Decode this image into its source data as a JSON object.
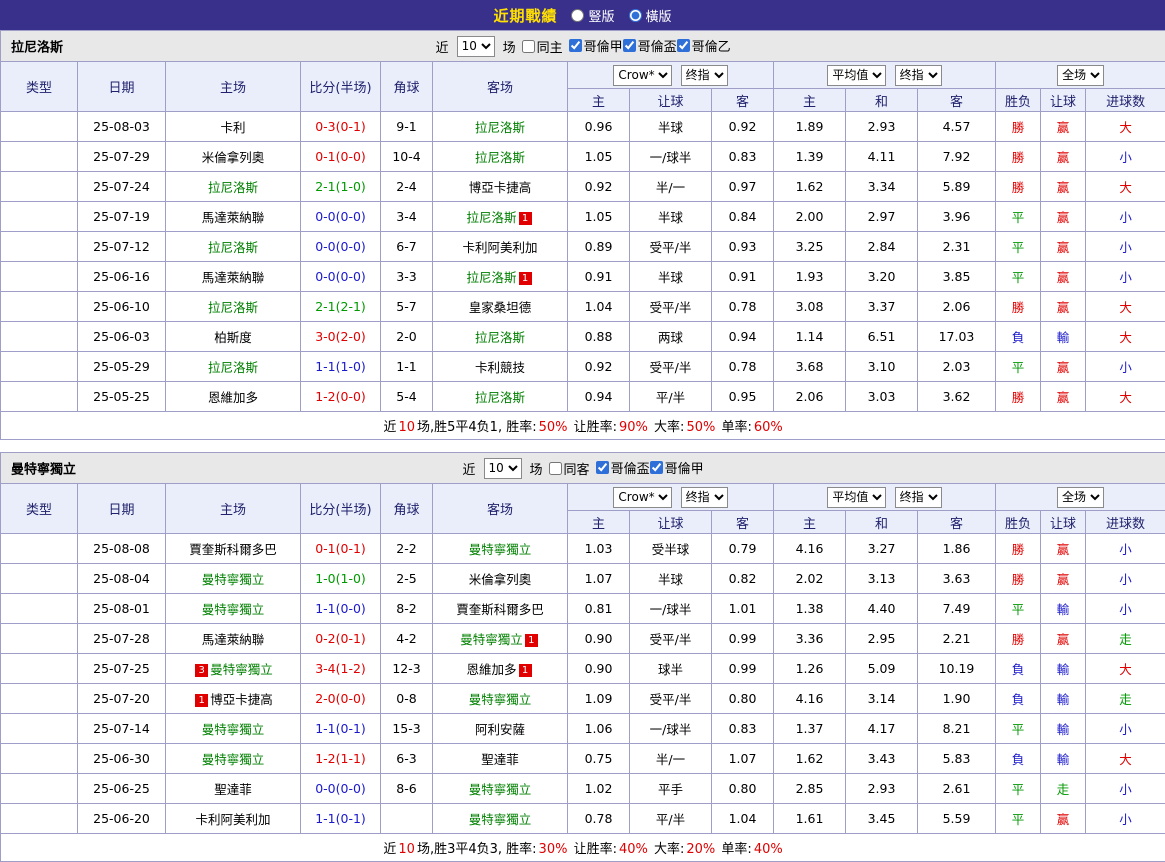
{
  "top_bar": {
    "title": "近期戰績",
    "options": [
      {
        "label": "豎版",
        "selected": false
      },
      {
        "label": "橫版",
        "selected": true
      }
    ]
  },
  "labels": {
    "recent": "近",
    "matches": "场"
  },
  "colors": {
    "topbar_bg": "#39308b",
    "title_yellow": "#ffe000",
    "league_red": "#d60000",
    "league_magenta": "#cc00cc",
    "win_red": "#e00000",
    "draw_green": "#009900",
    "lose_blue": "#1a1acc",
    "focal_team_green": "#008000",
    "header_bg": "#e9eefa"
  },
  "table_header": {
    "type": "类型",
    "date": "日期",
    "home": "主场",
    "score": "比分(半场)",
    "corner": "角球",
    "away": "客场",
    "selects": {
      "company": "Crow*",
      "final1": "终指",
      "average": "平均值",
      "final2": "终指",
      "scope": "全场"
    },
    "sub": {
      "home": "主",
      "handicap": "让球",
      "away": "客",
      "avg_home": "主",
      "draw": "和",
      "avg_away": "客",
      "result": "胜负",
      "handicap_result": "让球",
      "goals": "进球数"
    }
  },
  "sections": [
    {
      "team": "拉尼洛斯",
      "filters": {
        "recent_value": "10",
        "same_label": "同主",
        "same_checked": false,
        "leagues": [
          "哥倫甲",
          "哥倫盃",
          "哥倫乙"
        ]
      },
      "rows": [
        {
          "league": "哥倫甲",
          "league_color": "red",
          "date": "25-08-03",
          "home": {
            "name": "卡利",
            "focal": false
          },
          "score": {
            "text": "0-3(0-1)",
            "color": "red"
          },
          "corner": "9-1",
          "away": {
            "name": "拉尼洛斯",
            "focal": true
          },
          "crown": [
            "0.96",
            "半球",
            "0.92"
          ],
          "average": [
            "1.89",
            "2.93",
            "4.57"
          ],
          "result": [
            "勝",
            "red"
          ],
          "handicap": [
            "赢",
            "red"
          ],
          "goals": [
            "大",
            "red"
          ]
        },
        {
          "league": "哥倫甲",
          "league_color": "red",
          "date": "25-07-29",
          "home": {
            "name": "米倫拿列奧",
            "focal": false
          },
          "score": {
            "text": "0-1(0-0)",
            "color": "red"
          },
          "corner": "10-4",
          "away": {
            "name": "拉尼洛斯",
            "focal": true
          },
          "crown": [
            "1.05",
            "一/球半",
            "0.83"
          ],
          "average": [
            "1.39",
            "4.11",
            "7.92"
          ],
          "result": [
            "勝",
            "red"
          ],
          "handicap": [
            "赢",
            "red"
          ],
          "goals": [
            "小",
            "blue"
          ]
        },
        {
          "league": "哥倫甲",
          "league_color": "red",
          "date": "25-07-24",
          "home": {
            "name": "拉尼洛斯",
            "focal": true
          },
          "score": {
            "text": "2-1(1-0)",
            "color": "green"
          },
          "corner": "2-4",
          "away": {
            "name": "博亞卡捷高",
            "focal": false
          },
          "crown": [
            "0.92",
            "半/一",
            "0.97"
          ],
          "average": [
            "1.62",
            "3.34",
            "5.89"
          ],
          "result": [
            "勝",
            "red"
          ],
          "handicap": [
            "赢",
            "red"
          ],
          "goals": [
            "大",
            "red"
          ]
        },
        {
          "league": "哥倫甲",
          "league_color": "red",
          "date": "25-07-19",
          "home": {
            "name": "馬達萊納聯",
            "focal": false
          },
          "score": {
            "text": "0-0(0-0)",
            "color": "blue"
          },
          "corner": "3-4",
          "away": {
            "name": "拉尼洛斯",
            "focal": true,
            "post": "1"
          },
          "crown": [
            "1.05",
            "半球",
            "0.84"
          ],
          "average": [
            "2.00",
            "2.97",
            "3.96"
          ],
          "result": [
            "平",
            "green"
          ],
          "handicap": [
            "赢",
            "red"
          ],
          "goals": [
            "小",
            "blue"
          ]
        },
        {
          "league": "哥倫甲",
          "league_color": "red",
          "date": "25-07-12",
          "home": {
            "name": "拉尼洛斯",
            "focal": true
          },
          "score": {
            "text": "0-0(0-0)",
            "color": "blue"
          },
          "corner": "6-7",
          "away": {
            "name": "卡利阿美利加",
            "focal": false
          },
          "crown": [
            "0.89",
            "受平/半",
            "0.93"
          ],
          "average": [
            "3.25",
            "2.84",
            "2.31"
          ],
          "result": [
            "平",
            "green"
          ],
          "handicap": [
            "赢",
            "red"
          ],
          "goals": [
            "小",
            "blue"
          ]
        },
        {
          "league": "哥倫盃",
          "league_color": "magenta",
          "date": "25-06-16",
          "home": {
            "name": "馬達萊納聯",
            "focal": false
          },
          "score": {
            "text": "0-0(0-0)",
            "color": "blue"
          },
          "corner": "3-3",
          "away": {
            "name": "拉尼洛斯",
            "focal": true,
            "post": "1"
          },
          "crown": [
            "0.91",
            "半球",
            "0.91"
          ],
          "average": [
            "1.93",
            "3.20",
            "3.85"
          ],
          "result": [
            "平",
            "green"
          ],
          "handicap": [
            "赢",
            "red"
          ],
          "goals": [
            "小",
            "blue"
          ]
        },
        {
          "league": "哥倫盃",
          "league_color": "magenta",
          "date": "25-06-10",
          "home": {
            "name": "拉尼洛斯",
            "focal": true
          },
          "score": {
            "text": "2-1(2-1)",
            "color": "green"
          },
          "corner": "5-7",
          "away": {
            "name": "皇家桑坦德",
            "focal": false
          },
          "crown": [
            "1.04",
            "受平/半",
            "0.78"
          ],
          "average": [
            "3.08",
            "3.37",
            "2.06"
          ],
          "result": [
            "勝",
            "red"
          ],
          "handicap": [
            "赢",
            "red"
          ],
          "goals": [
            "大",
            "red"
          ]
        },
        {
          "league": "哥倫盃",
          "league_color": "magenta",
          "date": "25-06-03",
          "home": {
            "name": "柏斯度",
            "focal": false
          },
          "score": {
            "text": "3-0(2-0)",
            "color": "red"
          },
          "corner": "2-0",
          "away": {
            "name": "拉尼洛斯",
            "focal": true
          },
          "crown": [
            "0.88",
            "两球",
            "0.94"
          ],
          "average": [
            "1.14",
            "6.51",
            "17.03"
          ],
          "result": [
            "負",
            "blue"
          ],
          "handicap": [
            "輸",
            "blue"
          ],
          "goals": [
            "大",
            "red"
          ]
        },
        {
          "league": "哥倫盃",
          "league_color": "magenta",
          "date": "25-05-29",
          "home": {
            "name": "拉尼洛斯",
            "focal": true
          },
          "score": {
            "text": "1-1(1-0)",
            "color": "blue"
          },
          "corner": "1-1",
          "away": {
            "name": "卡利競技",
            "focal": false
          },
          "crown": [
            "0.92",
            "受平/半",
            "0.78"
          ],
          "average": [
            "3.68",
            "3.10",
            "2.03"
          ],
          "result": [
            "平",
            "green"
          ],
          "handicap": [
            "赢",
            "red"
          ],
          "goals": [
            "小",
            "blue"
          ]
        },
        {
          "league": "哥倫甲",
          "league_color": "red",
          "date": "25-05-25",
          "home": {
            "name": "恩維加多",
            "focal": false
          },
          "score": {
            "text": "1-2(0-0)",
            "color": "red"
          },
          "corner": "5-4",
          "away": {
            "name": "拉尼洛斯",
            "focal": true
          },
          "crown": [
            "0.94",
            "平/半",
            "0.95"
          ],
          "average": [
            "2.06",
            "3.03",
            "3.62"
          ],
          "result": [
            "勝",
            "red"
          ],
          "handicap": [
            "赢",
            "red"
          ],
          "goals": [
            "大",
            "red"
          ]
        }
      ],
      "summary": [
        [
          "近",
          ""
        ],
        [
          "10",
          "red"
        ],
        [
          "场,胜5平4负1, 胜率:",
          ""
        ],
        [
          "50%",
          "red"
        ],
        [
          " 让胜率:",
          ""
        ],
        [
          "90%",
          "red"
        ],
        [
          " 大率:",
          ""
        ],
        [
          "50%",
          "red"
        ],
        [
          " 单率:",
          ""
        ],
        [
          "60%",
          "red"
        ]
      ]
    },
    {
      "team": "曼特寧獨立",
      "filters": {
        "recent_value": "10",
        "same_label": "同客",
        "same_checked": false,
        "leagues": [
          "哥倫盃",
          "哥倫甲"
        ]
      },
      "rows": [
        {
          "league": "哥倫盃",
          "league_color": "magenta",
          "date": "25-08-08",
          "home": {
            "name": "賈奎斯科爾多巴",
            "focal": false
          },
          "score": {
            "text": "0-1(0-1)",
            "color": "red"
          },
          "corner": "2-2",
          "away": {
            "name": "曼特寧獨立",
            "focal": true
          },
          "crown": [
            "1.03",
            "受半球",
            "0.79"
          ],
          "average": [
            "4.16",
            "3.27",
            "1.86"
          ],
          "result": [
            "勝",
            "red"
          ],
          "handicap": [
            "赢",
            "red"
          ],
          "goals": [
            "小",
            "blue"
          ]
        },
        {
          "league": "哥倫甲",
          "league_color": "red",
          "date": "25-08-04",
          "home": {
            "name": "曼特寧獨立",
            "focal": true
          },
          "score": {
            "text": "1-0(1-0)",
            "color": "green"
          },
          "corner": "2-5",
          "away": {
            "name": "米倫拿列奧",
            "focal": false
          },
          "crown": [
            "1.07",
            "半球",
            "0.82"
          ],
          "average": [
            "2.02",
            "3.13",
            "3.63"
          ],
          "result": [
            "勝",
            "red"
          ],
          "handicap": [
            "赢",
            "red"
          ],
          "goals": [
            "小",
            "blue"
          ]
        },
        {
          "league": "哥倫盃",
          "league_color": "magenta",
          "date": "25-08-01",
          "home": {
            "name": "曼特寧獨立",
            "focal": true
          },
          "score": {
            "text": "1-1(0-0)",
            "color": "blue"
          },
          "corner": "8-2",
          "away": {
            "name": "賈奎斯科爾多巴",
            "focal": false
          },
          "crown": [
            "0.81",
            "一/球半",
            "1.01"
          ],
          "average": [
            "1.38",
            "4.40",
            "7.49"
          ],
          "result": [
            "平",
            "green"
          ],
          "handicap": [
            "輸",
            "blue"
          ],
          "goals": [
            "小",
            "blue"
          ]
        },
        {
          "league": "哥倫甲",
          "league_color": "red",
          "date": "25-07-28",
          "home": {
            "name": "馬達萊納聯",
            "focal": false
          },
          "score": {
            "text": "0-2(0-1)",
            "color": "red"
          },
          "corner": "4-2",
          "away": {
            "name": "曼特寧獨立",
            "focal": true,
            "post": "1"
          },
          "crown": [
            "0.90",
            "受平/半",
            "0.99"
          ],
          "average": [
            "3.36",
            "2.95",
            "2.21"
          ],
          "result": [
            "勝",
            "red"
          ],
          "handicap": [
            "赢",
            "red"
          ],
          "goals": [
            "走",
            "green"
          ]
        },
        {
          "league": "哥倫甲",
          "league_color": "red",
          "date": "25-07-25",
          "home": {
            "name": "曼特寧獨立",
            "focal": true,
            "pre": "3"
          },
          "score": {
            "text": "3-4(1-2)",
            "color": "red"
          },
          "corner": "12-3",
          "away": {
            "name": "恩維加多",
            "focal": false,
            "post": "1"
          },
          "crown": [
            "0.90",
            "球半",
            "0.99"
          ],
          "average": [
            "1.26",
            "5.09",
            "10.19"
          ],
          "result": [
            "負",
            "blue"
          ],
          "handicap": [
            "輸",
            "blue"
          ],
          "goals": [
            "大",
            "red"
          ]
        },
        {
          "league": "哥倫甲",
          "league_color": "red",
          "date": "25-07-20",
          "home": {
            "name": "博亞卡捷高",
            "focal": false,
            "pre": "1"
          },
          "score": {
            "text": "2-0(0-0)",
            "color": "red"
          },
          "corner": "0-8",
          "away": {
            "name": "曼特寧獨立",
            "focal": true
          },
          "crown": [
            "1.09",
            "受平/半",
            "0.80"
          ],
          "average": [
            "4.16",
            "3.14",
            "1.90"
          ],
          "result": [
            "負",
            "blue"
          ],
          "handicap": [
            "輸",
            "blue"
          ],
          "goals": [
            "走",
            "green"
          ]
        },
        {
          "league": "哥倫甲",
          "league_color": "red",
          "date": "25-07-14",
          "home": {
            "name": "曼特寧獨立",
            "focal": true
          },
          "score": {
            "text": "1-1(0-1)",
            "color": "blue"
          },
          "corner": "15-3",
          "away": {
            "name": "阿利安薩",
            "focal": false
          },
          "crown": [
            "1.06",
            "一/球半",
            "0.83"
          ],
          "average": [
            "1.37",
            "4.17",
            "8.21"
          ],
          "result": [
            "平",
            "green"
          ],
          "handicap": [
            "輸",
            "blue"
          ],
          "goals": [
            "小",
            "blue"
          ]
        },
        {
          "league": "哥倫甲",
          "league_color": "red",
          "date": "25-06-30",
          "home": {
            "name": "曼特寧獨立",
            "focal": true
          },
          "score": {
            "text": "1-2(1-1)",
            "color": "red"
          },
          "corner": "6-3",
          "away": {
            "name": "聖達菲",
            "focal": false
          },
          "crown": [
            "0.75",
            "半/一",
            "1.07"
          ],
          "average": [
            "1.62",
            "3.43",
            "5.83"
          ],
          "result": [
            "負",
            "blue"
          ],
          "handicap": [
            "輸",
            "blue"
          ],
          "goals": [
            "大",
            "red"
          ]
        },
        {
          "league": "哥倫甲",
          "league_color": "red",
          "date": "25-06-25",
          "home": {
            "name": "聖達菲",
            "focal": false
          },
          "score": {
            "text": "0-0(0-0)",
            "color": "blue"
          },
          "corner": "8-6",
          "away": {
            "name": "曼特寧獨立",
            "focal": true
          },
          "crown": [
            "1.02",
            "平手",
            "0.80"
          ],
          "average": [
            "2.85",
            "2.93",
            "2.61"
          ],
          "result": [
            "平",
            "green"
          ],
          "handicap": [
            "走",
            "green"
          ],
          "goals": [
            "小",
            "blue"
          ]
        },
        {
          "league": "哥倫甲",
          "league_color": "red",
          "date": "25-06-20",
          "home": {
            "name": "卡利阿美利加",
            "focal": false
          },
          "score": {
            "text": "1-1(0-1)",
            "color": "blue"
          },
          "corner": "",
          "away": {
            "name": "曼特寧獨立",
            "focal": true
          },
          "crown": [
            "0.78",
            "平/半",
            "1.04"
          ],
          "average": [
            "1.61",
            "3.45",
            "5.59"
          ],
          "result": [
            "平",
            "green"
          ],
          "handicap": [
            "赢",
            "red"
          ],
          "goals": [
            "小",
            "blue"
          ]
        }
      ],
      "summary": [
        [
          "近",
          ""
        ],
        [
          "10",
          "red"
        ],
        [
          "场,胜3平4负3, 胜率:",
          ""
        ],
        [
          "30%",
          "red"
        ],
        [
          " 让胜率:",
          ""
        ],
        [
          "40%",
          "red"
        ],
        [
          " 大率:",
          ""
        ],
        [
          "20%",
          "red"
        ],
        [
          " 单率:",
          ""
        ],
        [
          "40%",
          "red"
        ]
      ]
    }
  ]
}
